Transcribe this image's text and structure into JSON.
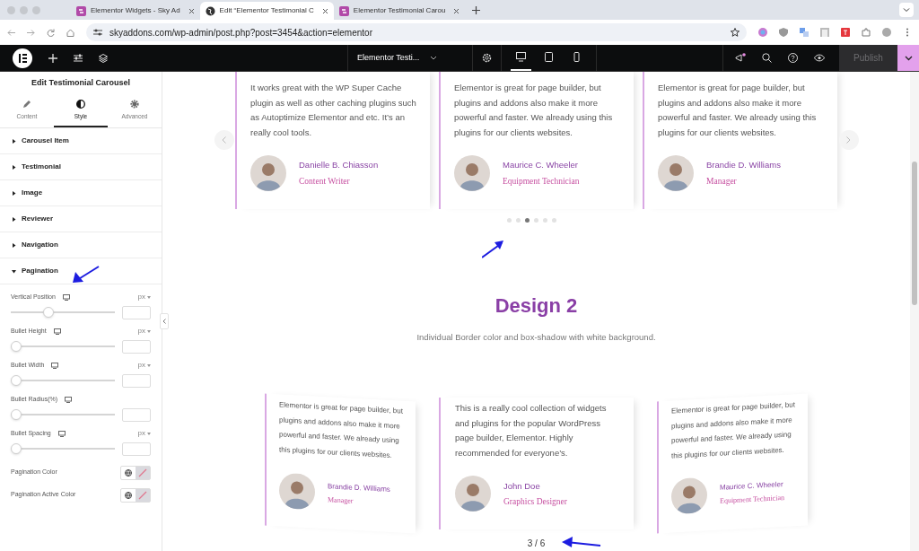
{
  "browser": {
    "tabs": [
      {
        "title": "Elementor Widgets - Sky Ad",
        "kind": "site",
        "selected": false
      },
      {
        "title": "Edit “Elementor Testimonial C",
        "kind": "editor",
        "selected": true
      },
      {
        "title": "Elementor Testimonial Carou",
        "kind": "site",
        "selected": false
      }
    ],
    "url": "skyaddons.com/wp-admin/post.php?post=3454&action=elementor"
  },
  "editor_bar": {
    "document_title": "Elementor Testi...",
    "devices": [
      {
        "kind": "desktop",
        "selected": true
      },
      {
        "kind": "tablet",
        "selected": false
      },
      {
        "kind": "mobile",
        "selected": false
      }
    ],
    "publish_button": {
      "label": "Publish",
      "disabled": true
    }
  },
  "panel": {
    "title": "Edit Testimonial Carousel",
    "tabs": [
      {
        "label": "Content",
        "kind": "pencil",
        "selected": false
      },
      {
        "label": "Style",
        "kind": "contrast",
        "selected": true
      },
      {
        "label": "Advanced",
        "kind": "gear",
        "selected": false
      }
    ],
    "sections": [
      {
        "label": "Carousel Item",
        "expanded": false
      },
      {
        "label": "Testimonial",
        "expanded": false
      },
      {
        "label": "Image",
        "expanded": false
      },
      {
        "label": "Reviewer",
        "expanded": false
      },
      {
        "label": "Navigation",
        "expanded": false
      },
      {
        "label": "Pagination",
        "expanded": true
      }
    ],
    "controls": [
      {
        "kind": "slider",
        "label": "Vertical Position",
        "unit": "px",
        "level": 0.35
      },
      {
        "kind": "slider",
        "label": "Bullet Height",
        "unit": "px",
        "level": 0
      },
      {
        "kind": "slider",
        "label": "Bullet Width",
        "unit": "px",
        "level": 0
      },
      {
        "kind": "slider",
        "label": "Bullet Radius(%)",
        "level": 0
      },
      {
        "kind": "slider",
        "label": "Bullet Spacing",
        "unit": "px",
        "level": 0
      },
      {
        "kind": "color",
        "label": "Pagination Color"
      },
      {
        "kind": "color",
        "label": "Pagination Active Color"
      }
    ]
  },
  "carousel_1": {
    "cards": [
      {
        "text": "It works great with the WP Super Cache plugin as well as other caching plugins such as Autoptimize Elementor and etc. It’s an really cool tools.",
        "name": "Danielle B. Chiasson",
        "role": "Content Writer"
      },
      {
        "text": "Elementor is great for page builder, but plugins and addons also make it more powerful and faster. We already using this plugins for our clients websites.",
        "name": "Maurice C. Wheeler",
        "role": "Equipment Technician"
      },
      {
        "text": "Elementor is great for page builder, but plugins and addons also make it more powerful and faster. We already using this plugins for our clients websites.",
        "name": "Brandie D. Williams",
        "role": "Manager"
      }
    ],
    "dots": [
      {
        "selected": false
      },
      {
        "selected": false
      },
      {
        "selected": true
      },
      {
        "selected": false
      },
      {
        "selected": false
      },
      {
        "selected": false
      }
    ]
  },
  "design_2": {
    "heading": "Design 2",
    "subtitle": "Individual Border color and box-shadow with white background.",
    "cards": [
      {
        "text": "Elementor is great for page builder, but plugins and addons also make it more powerful and faster. We already using this plugins for our clients websites.",
        "name": "Brandie D. Williams",
        "role": "Manager",
        "kind": "left"
      },
      {
        "text": "This is a really cool collection of widgets and plugins for the popular WordPress page builder, Elementor. Highly recommended for everyone’s.",
        "name": "John Doe",
        "role": "Graphics Designer",
        "kind": "center"
      },
      {
        "text": "Elementor is great for page builder, but plugins and addons also make it more powerful and faster. We already using this plugins for our clients websites.",
        "name": "Maurice C. Wheeler",
        "role": "Equipment Technician",
        "kind": "right"
      }
    ],
    "pagination": "3 / 6"
  }
}
